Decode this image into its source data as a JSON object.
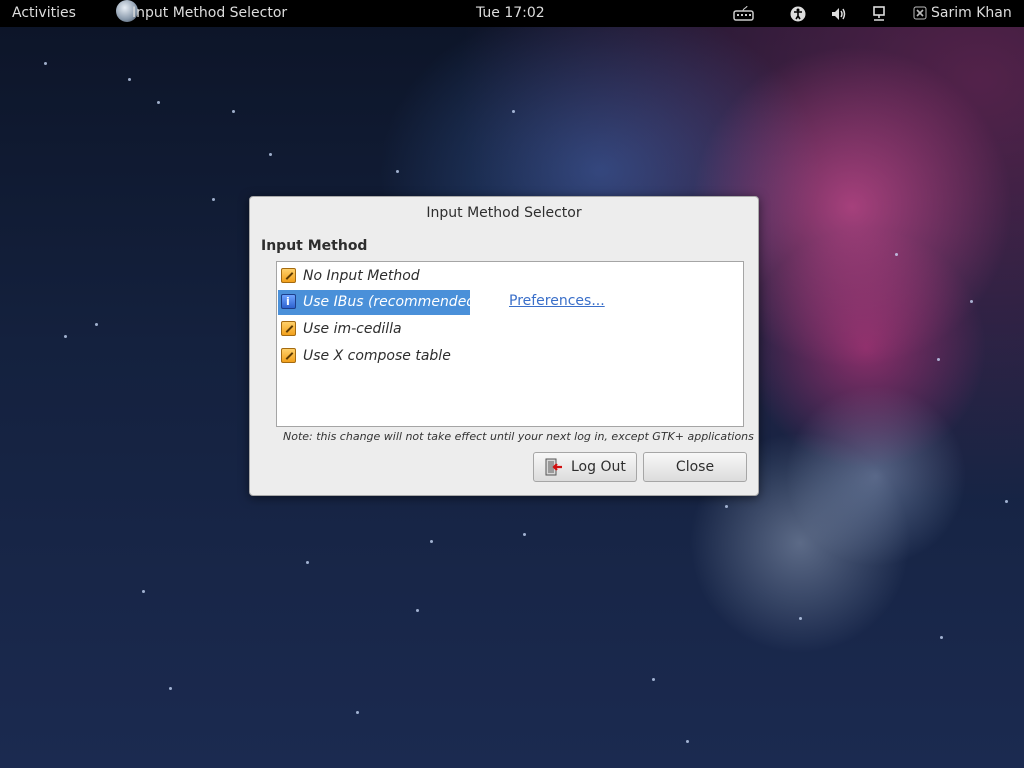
{
  "topbar": {
    "activities": "Activities",
    "app_title": "Input Method Selector",
    "clock": "Tue 17:02",
    "user_name": "Sarim Khan",
    "tray_icons": [
      "keyboard-icon",
      "accessibility-icon",
      "volume-icon",
      "network-icon",
      "user-status-icon"
    ]
  },
  "dialog": {
    "title": "Input Method Selector",
    "section_label": "Input Method",
    "options": [
      {
        "label": "No Input Method",
        "selected": false
      },
      {
        "label": "Use IBus (recommended)",
        "selected": true
      },
      {
        "label": "Use im-cedilla",
        "selected": false
      },
      {
        "label": "Use X compose table",
        "selected": false
      }
    ],
    "preferences_link": "Preferences...",
    "note": "Note: this change will not take effect until your next log in, except GTK+ applications",
    "logout_label": "Log Out",
    "close_label": "Close"
  },
  "colors": {
    "selection": "#4a90d9",
    "link": "#3a6fc9",
    "topbar_bg": "#000000"
  }
}
